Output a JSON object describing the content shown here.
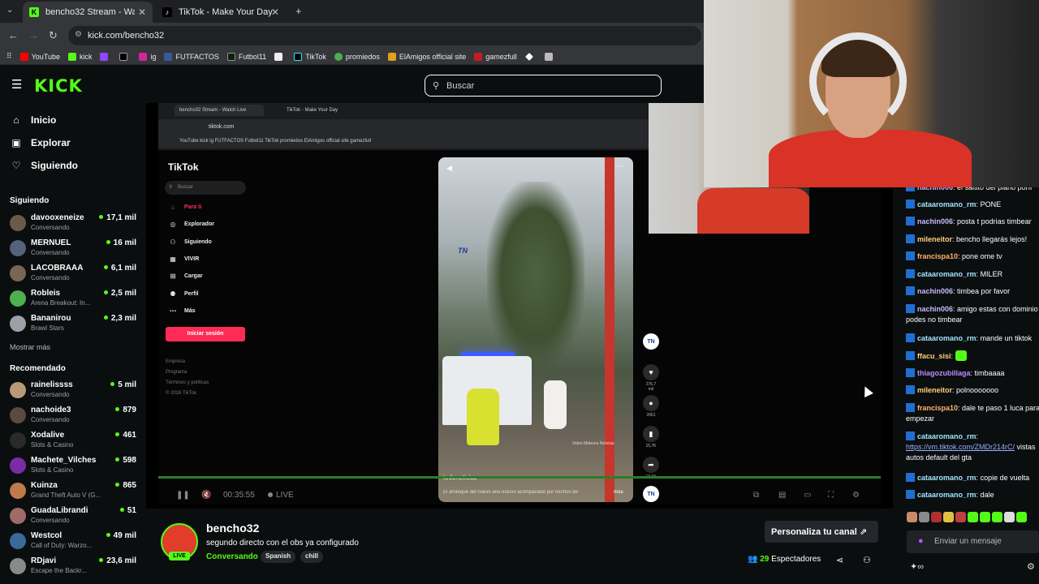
{
  "browser": {
    "tabs": [
      {
        "title": "bencho32 Stream - Watch Live",
        "favicon": "K"
      },
      {
        "title": "TikTok - Make Your Day",
        "favicon": "♪"
      }
    ],
    "url": "kick.com/bencho32",
    "bookmarks": [
      "YouTube",
      "kick",
      "",
      "",
      "ig",
      "FUTFACTOS",
      "Futbol11",
      "",
      "TikTok",
      "promiedos",
      "ElAmigos official site",
      "gamezfull",
      "",
      ""
    ]
  },
  "kick": {
    "logo": "KICK",
    "search_placeholder": "Buscar",
    "nav": [
      {
        "label": "Inicio",
        "icon": "home-icon"
      },
      {
        "label": "Explorar",
        "icon": "explore-icon"
      },
      {
        "label": "Siguiendo",
        "icon": "heart-icon"
      }
    ],
    "following_header": "Siguiendo",
    "following": [
      {
        "name": "davooxeneize",
        "game": "Conversando",
        "viewers": "17,1 mil",
        "color": "#6b5a48"
      },
      {
        "name": "MERNUEL",
        "game": "Conversando",
        "viewers": "16 mil",
        "color": "#54627a"
      },
      {
        "name": "LACOBRAAA",
        "game": "Conversando",
        "viewers": "6,1 mil",
        "color": "#7a6650"
      },
      {
        "name": "Robleis",
        "game": "Arena Breakout: In...",
        "viewers": "2,5 mil",
        "color": "#4caf50"
      },
      {
        "name": "Bananirou",
        "game": "Brawl Stars",
        "viewers": "2,3 mil",
        "color": "#9aa0a6"
      }
    ],
    "show_more": "Mostrar más",
    "recommended_header": "Recomendado",
    "recommended": [
      {
        "name": "rainelissss",
        "game": "Conversando",
        "viewers": "5 mil",
        "color": "#b89a7a"
      },
      {
        "name": "nachoide3",
        "game": "Conversando",
        "viewers": "879",
        "color": "#5a4a40"
      },
      {
        "name": "Xodalive",
        "game": "Slots & Casino",
        "viewers": "461",
        "color": "#2a2a2a"
      },
      {
        "name": "Machete_Vilches",
        "game": "Slots & Casino",
        "viewers": "598",
        "color": "#7a2ca8"
      },
      {
        "name": "Kuinza",
        "game": "Grand Theft Auto V (G...",
        "viewers": "865",
        "color": "#c07a4a"
      },
      {
        "name": "GuadaLibrandi",
        "game": "Conversando",
        "viewers": "51",
        "color": "#a06a6a"
      },
      {
        "name": "Westcol",
        "game": "Call of Duty: Warzo...",
        "viewers": "49 mil",
        "color": "#3a6a9a"
      },
      {
        "name": "RDjavi",
        "game": "Escape the Backr...",
        "viewers": "23,6 mil",
        "color": "#8a8a8a"
      }
    ]
  },
  "player": {
    "inner_tabs": [
      "bencho32 Stream - Watch Live",
      "TikTok - Make Your Day"
    ],
    "inner_url": "tiktok.com",
    "inner_bookmarks": "YouTube   kick   ig   FUTFACTOS   Futbol11   TikTok   promiedos   ElAmigos official site   gamezfull",
    "tiktok": {
      "logo": "TikTok",
      "search": "Buscar",
      "nav": [
        {
          "label": "Para ti",
          "icon": "home-icon"
        },
        {
          "label": "Explorador",
          "icon": "compass-icon"
        },
        {
          "label": "Siguiendo",
          "icon": "following-icon"
        },
        {
          "label": "VIVIR",
          "icon": "live-icon"
        },
        {
          "label": "Cargar",
          "icon": "upload-icon"
        },
        {
          "label": "Perfil",
          "icon": "profile-icon"
        },
        {
          "label": "Más",
          "icon": "more-icon"
        }
      ],
      "login": "Iniciar sesión",
      "footer": [
        "Empresa",
        "Programa",
        "Términos y políticas",
        "© 2026 TikTok"
      ],
      "video_author": "todonoticias",
      "video_caption": "El arranque del nuevo año estuvo acompañado por hechos de",
      "video_more": "más",
      "watermark": "Video Meteora Noticias",
      "channel_logo": "TN",
      "counts": {
        "likes": "276,7 mil",
        "comments": "2061",
        "saves": "15,7K",
        "shares": "13,1K"
      }
    },
    "time": "00:35:55",
    "live": "LIVE"
  },
  "stream": {
    "name": "bencho32",
    "title": "segundo directo con el obs ya configurado",
    "category": "Conversando",
    "tags": [
      "Spanish",
      "chill"
    ],
    "customize": "Personaliza tu canal",
    "viewers_count": "29",
    "viewers_label": "Espectadores",
    "live_badge": "LIVE"
  },
  "chat": {
    "messages": [
      {
        "user": "nachin006",
        "text": "el saltito del piano porfi",
        "color": "#c9b8ff"
      },
      {
        "user": "cataaromano_rm",
        "text": "PONE",
        "color": "#9ee6ff"
      },
      {
        "user": "nachin006",
        "text": "posta t podrias timbear",
        "color": "#c9b8ff"
      },
      {
        "user": "mileneitor",
        "text": "bencho llegarás lejos!",
        "color": "#ffd27a"
      },
      {
        "user": "francispa10",
        "text": "pone ome tv",
        "color": "#ffb36b"
      },
      {
        "user": "cataaromano_rm",
        "text": "MILER",
        "color": "#9ee6ff"
      },
      {
        "user": "nachin006",
        "text": "timbea por favor",
        "color": "#c9b8ff"
      },
      {
        "user": "nachin006",
        "text": "amigo estas con dominio podes no timbear",
        "color": "#c9b8ff"
      },
      {
        "user": "cataaromano_rm",
        "text": "mande un tiktok",
        "color": "#9ee6ff"
      },
      {
        "user": "ffacu_sisi",
        "text": "",
        "color": "#ffd27a"
      },
      {
        "user": "thiagozubillaga",
        "text": "timbaaaa",
        "color": "#b78cff"
      },
      {
        "user": "mileneitor",
        "text": "polnooooooo",
        "color": "#ffd27a"
      },
      {
        "user": "francispa10",
        "text": "dale te paso 1 luca para empezar",
        "color": "#ffb36b"
      },
      {
        "user": "cataaromano_rm",
        "text": "",
        "link": "https://vm.tiktok.com/ZMDr214rC/",
        "text2": " vistas autos default del gta",
        "color": "#9ee6ff"
      },
      {
        "user": "cataaromano_rm",
        "text": "copie de vuelta",
        "color": "#9ee6ff"
      },
      {
        "user": "cataaromano_rm",
        "text": "dale",
        "color": "#9ee6ff"
      }
    ],
    "input_placeholder": "Enviar un mensaje"
  },
  "colors": {
    "accent": "#53fc18",
    "bg": "#0b0e0f"
  }
}
